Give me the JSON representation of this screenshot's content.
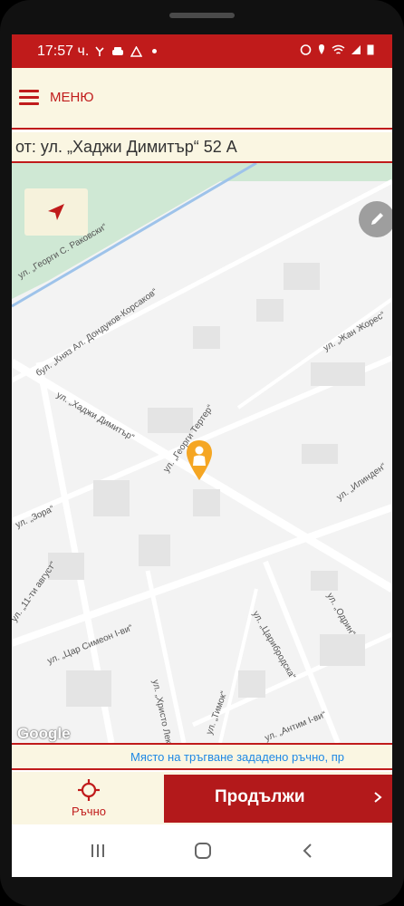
{
  "status_bar": {
    "time": "17:57 ч."
  },
  "app_bar": {
    "menu_label": "МЕНЮ"
  },
  "address": {
    "text": "от: ул. „Хаджи Димитър“ 52 А"
  },
  "map": {
    "streets": [
      "ул. „Георги С. Раковски“",
      "бул. „Княз Ал. Дондуков-Корсаков“",
      "ул. „Хаджи Димитър“",
      "ул. „Георги Тертер“",
      "ул. „Жан Жорес“",
      "ул. „Илинден“",
      "ул. „Зора“",
      "ул. „11-ти август“",
      "ул. „Цар Симеон I-ви“",
      "ул. „Христо Лекарски“",
      "ул. „Царибродска“",
      "ул. „Одрин“",
      "ул. „Тимок“",
      "ул. „Антим I-ви“"
    ],
    "logo": "Google",
    "pin_color": "#f5a623"
  },
  "info": {
    "message": "Място на тръгване зададено ръчно, пр"
  },
  "bottom": {
    "manual_label": "Ръчно",
    "continue_label": "Продължи"
  },
  "colors": {
    "accent": "#c01b1b",
    "cream": "#faf6e2"
  }
}
